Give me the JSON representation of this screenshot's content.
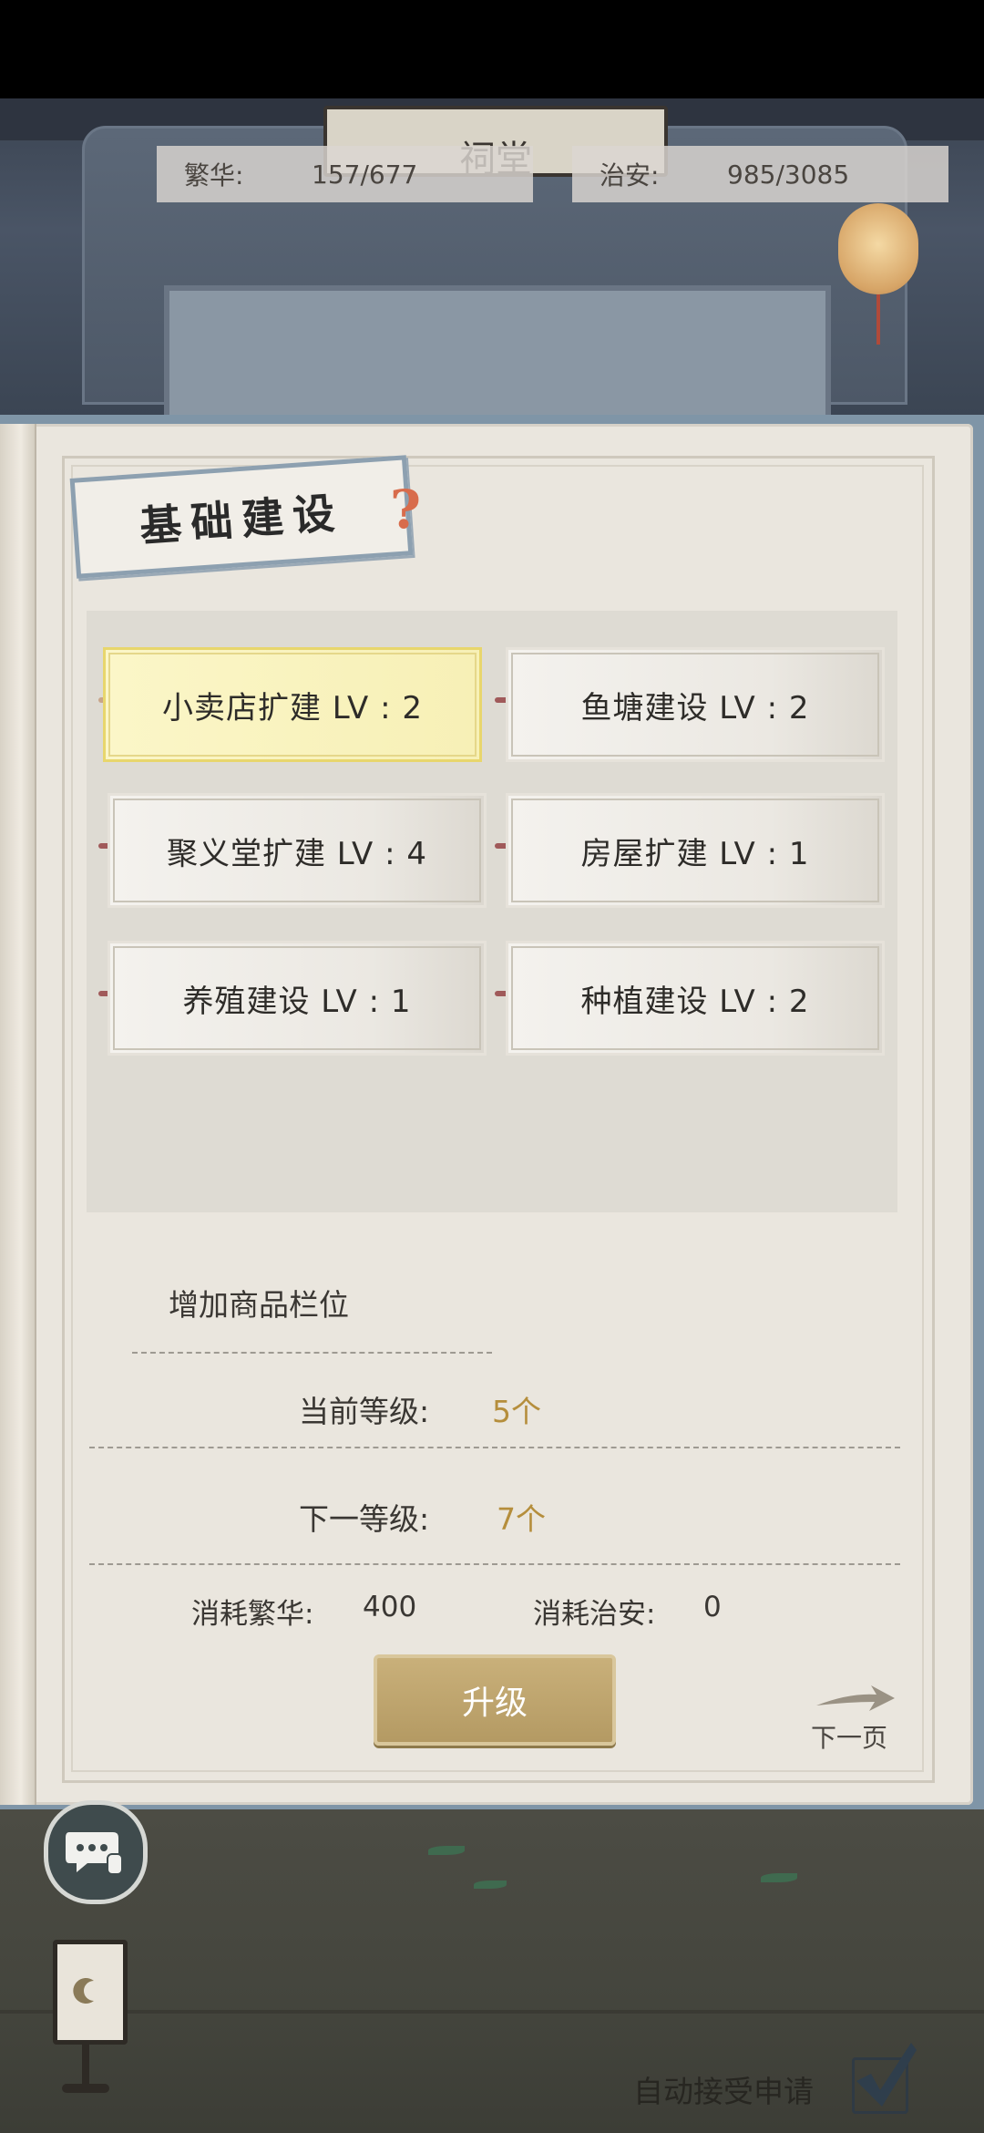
{
  "stats": {
    "prosperity_label": "繁华:",
    "prosperity_value": "157/677",
    "security_label": "治安:",
    "security_value": "985/3085"
  },
  "scene": {
    "plaque_text": "祠堂"
  },
  "panel": {
    "title": "基础建设",
    "help_icon": "?",
    "buildings": [
      {
        "label": "小卖店扩建 LV : 2",
        "selected": true
      },
      {
        "label": "鱼塘建设 LV : 2",
        "selected": false
      },
      {
        "label": "聚义堂扩建 LV : 4",
        "selected": false
      },
      {
        "label": "房屋扩建 LV : 1",
        "selected": false
      },
      {
        "label": "养殖建设 LV : 1",
        "selected": false
      },
      {
        "label": "种植建设 LV : 2",
        "selected": false
      }
    ]
  },
  "detail": {
    "description": "增加商品栏位",
    "current_label": "当前等级:",
    "current_value": "5个",
    "next_label": "下一等级:",
    "next_value": "7个",
    "cost_prosperity_label": "消耗繁华:",
    "cost_prosperity_value": "400",
    "cost_security_label": "消耗治安:",
    "cost_security_value": "0",
    "upgrade_button": "升级",
    "next_page": "下一页"
  },
  "footer": {
    "auto_accept_label": "自动接受申请",
    "auto_accept_checked": true
  },
  "colors": {
    "selected_card": "#f7f0b6",
    "value_gold": "#b58e3c",
    "upgrade_button": "#b49a63",
    "page_bg": "#eae6de"
  }
}
